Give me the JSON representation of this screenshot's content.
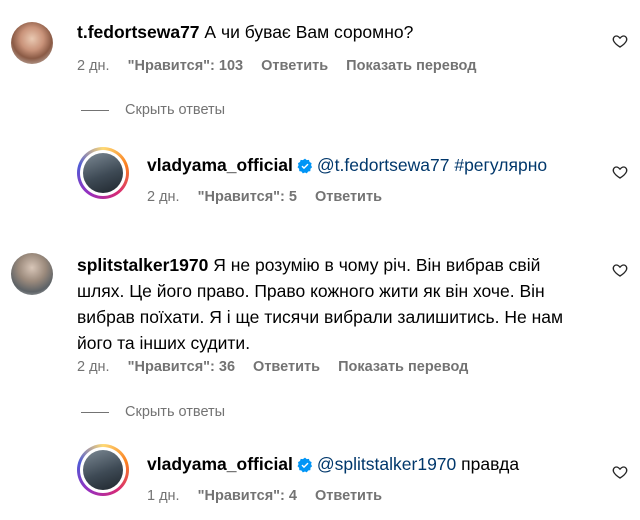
{
  "comments": [
    {
      "username": "t.fedortsewa77",
      "text": "А чи буває Вам соромно?",
      "time": "2 дн.",
      "likes": "\"Нравится\": 103",
      "reply_label": "Ответить",
      "translate_label": "Показать перевод",
      "hide_replies": "Скрыть ответы",
      "reply": {
        "username": "vladyama_official",
        "mention": "@t.fedortsewa77",
        "text": "#регулярно",
        "time": "2 дн.",
        "likes": "\"Нравится\": 5",
        "reply_label": "Ответить"
      }
    },
    {
      "username": "splitstalker1970",
      "text_line1": "Я не розумію в чому річ. Він вибрав свій",
      "text_line2": "шлях. Це його право. Право кожного жити як він хоче. Він",
      "text_line3": "вибрав поїхати. Я і ще тисячи вибрали залишитись. Не нам",
      "text_line4": "його та інших судити.",
      "time": "2 дн.",
      "likes": "\"Нравится\": 36",
      "reply_label": "Ответить",
      "translate_label": "Показать перевод",
      "hide_replies": "Скрыть ответы",
      "reply": {
        "username": "vladyama_official",
        "mention": "@splitstalker1970",
        "text": "правда",
        "time": "1 дн.",
        "likes": "\"Нравится\": 4",
        "reply_label": "Ответить"
      }
    }
  ],
  "colors": {
    "mention": "#00376b",
    "meta": "#737373",
    "verified": "#0095f6"
  },
  "icons": [
    "heart-icon",
    "verified-badge-icon"
  ]
}
